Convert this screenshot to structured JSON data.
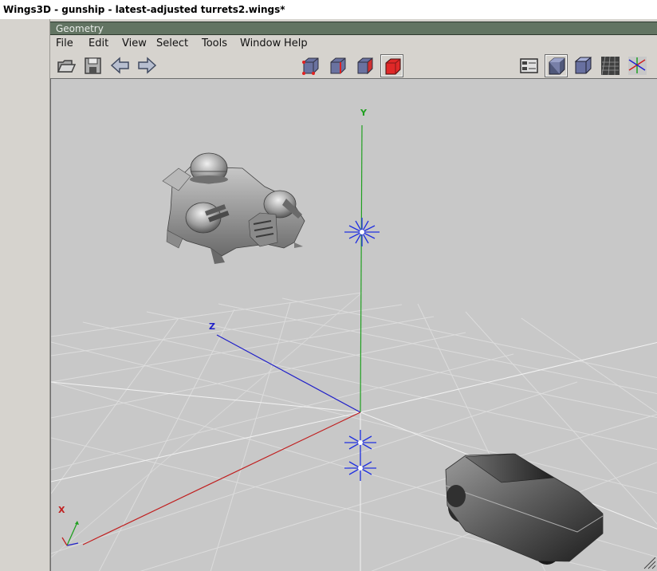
{
  "window_title": "Wings3D - gunship - latest-adjusted turrets2.wings*",
  "geometry_title": "Geometry",
  "menu": [
    "File",
    "Edit",
    "View",
    "Select",
    "Tools",
    "Window",
    "Help"
  ],
  "toolbar": {
    "left": [
      "open-icon",
      "save-icon",
      "undo-icon",
      "redo-icon"
    ],
    "selection_modes": [
      "vertex-mode-icon",
      "edge-mode-icon",
      "face-mode-icon",
      "body-mode-icon"
    ],
    "active_mode": "body-mode-icon",
    "right": [
      "outliner-icon",
      "smooth-shading-icon",
      "wireframe-shading-icon",
      "ground-grid-icon",
      "axes-icon"
    ]
  },
  "viewport": {
    "axis_labels": {
      "y": "Y",
      "z": "Z",
      "x": "X"
    },
    "colors": {
      "background": "#c8c8c8",
      "y_axis": "#20a020",
      "z_axis": "#2020c8",
      "x_axis": "#c02020",
      "light": "#2030e0"
    }
  }
}
